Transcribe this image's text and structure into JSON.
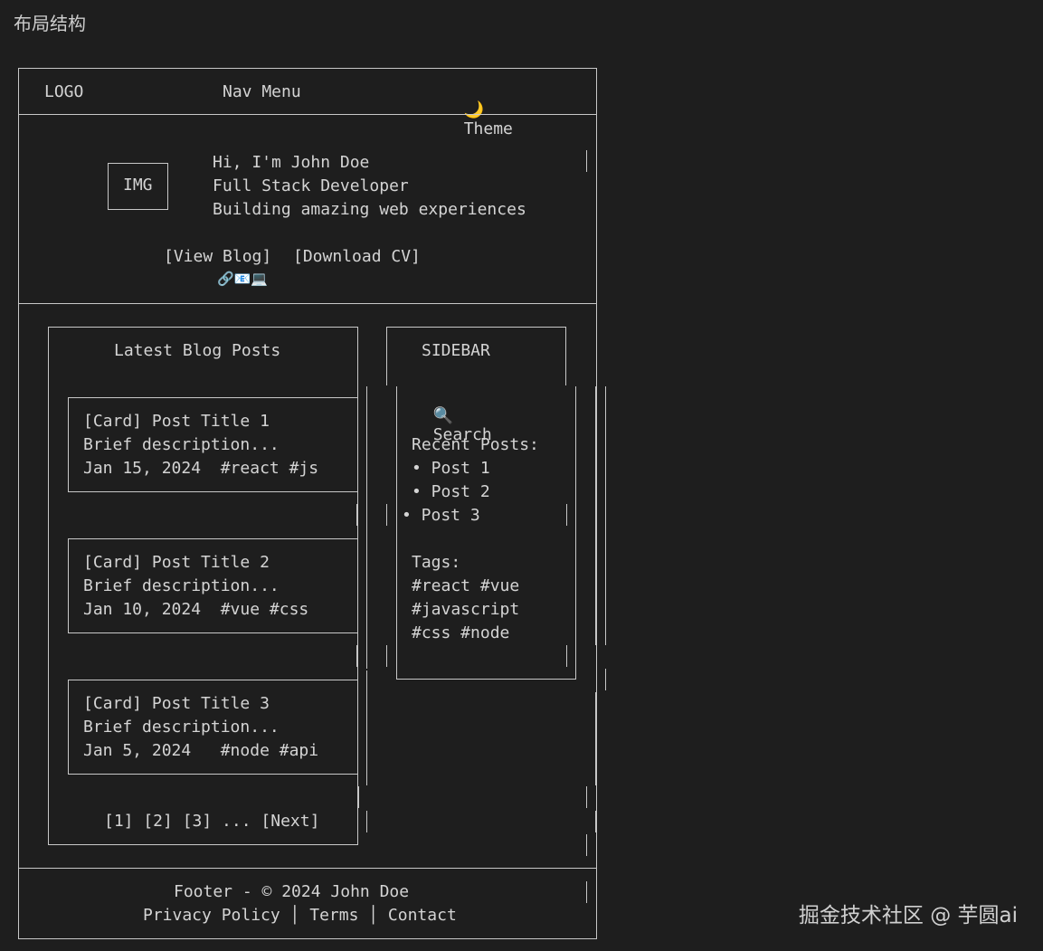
{
  "page_title": "布局结构",
  "header": {
    "logo": "LOGO",
    "nav": "Nav Menu",
    "theme_icon": "🌙",
    "theme_label": "Theme"
  },
  "hero": {
    "img": "IMG",
    "greeting": "Hi, I'm John Doe",
    "role": "Full Stack Developer",
    "tagline": "Building amazing web experiences",
    "btn_blog": "[View Blog]",
    "btn_cv": "[Download CV]",
    "social_icons": "🔗📧💻"
  },
  "blog": {
    "heading": "Latest Blog Posts",
    "cards": [
      {
        "title": "[Card] Post Title 1",
        "desc": "Brief description...",
        "meta": "Jan 15, 2024  #react #js"
      },
      {
        "title": "[Card] Post Title 2",
        "desc": "Brief description...",
        "meta": "Jan 10, 2024  #vue #css"
      },
      {
        "title": "[Card] Post Title 3",
        "desc": "Brief description...",
        "meta": "Jan 5, 2024   #node #api"
      }
    ],
    "pagination": "[1] [2] [3] ... [Next]"
  },
  "sidebar": {
    "heading": "SIDEBAR",
    "search_icon": "🔍",
    "search_label": "Search",
    "recent_heading": "Recent Posts:",
    "recent": [
      "• Post 1",
      "• Post 2",
      "• Post 3"
    ],
    "tags_heading": "Tags:",
    "tags": [
      "#react #vue",
      "#javascript",
      "#css #node"
    ]
  },
  "footer": {
    "line1": "Footer - © 2024 John Doe",
    "line2": "Privacy Policy │ Terms │ Contact"
  },
  "watermark": "掘金技术社区 @ 芋圆ai"
}
